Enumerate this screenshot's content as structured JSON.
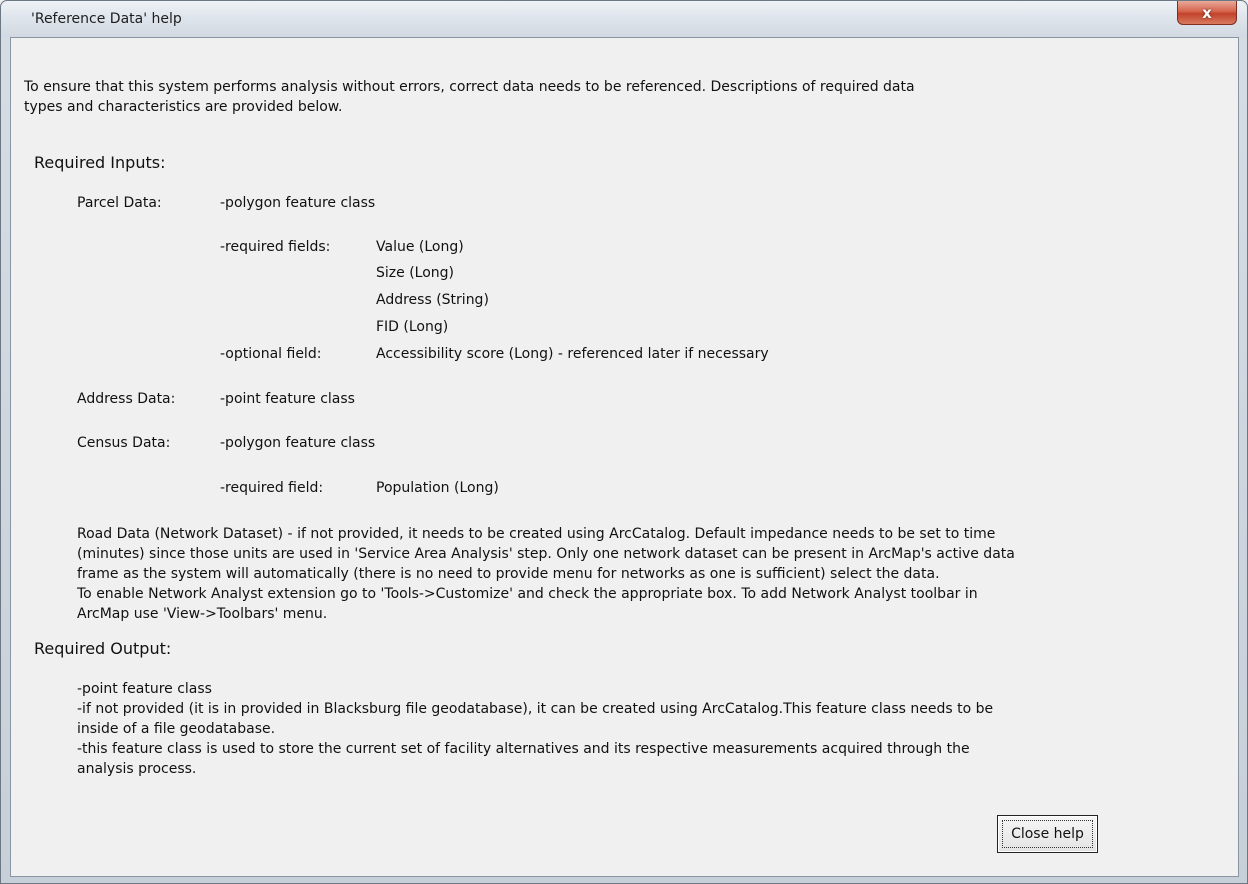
{
  "window": {
    "title": "'Reference Data' help",
    "close_glyph": "x",
    "close_icon_name": "close-icon"
  },
  "intro": {
    "line1": "To ensure that this system performs analysis without errors, correct data needs to be referenced. Descriptions of required data",
    "line2": "types and characteristics are provided below."
  },
  "required_inputs": {
    "heading": "Required Inputs:",
    "parcel": {
      "label": "Parcel Data:",
      "type": "-polygon feature class",
      "required_fields_label": "-required fields:",
      "required_fields": [
        "Value (Long)",
        "Size (Long)",
        "Address (String)",
        "FID (Long)"
      ],
      "optional_field_label": "-optional field:",
      "optional_field": "Accessibility score (Long) - referenced later if necessary"
    },
    "address": {
      "label": "Address Data:",
      "type": "-point feature class"
    },
    "census": {
      "label": "Census Data:",
      "type": "-polygon feature class",
      "required_field_label": "-required field:",
      "required_field": "Population (Long)"
    },
    "road": {
      "lines": [
        "Road Data (Network Dataset) - if not provided, it needs to be created using ArcCatalog. Default impedance needs to be set to time",
        "(minutes) since those units are used in 'Service Area Analysis' step. Only one network dataset can be present in ArcMap's active data",
        "frame as the system will automatically (there is no need to provide menu for networks as one is sufficient) select the data.",
        "To enable Network Analyst extension go to 'Tools->Customize' and check the appropriate box. To add Network Analyst toolbar in",
        "ArcMap use 'View->Toolbars' menu."
      ]
    }
  },
  "required_output": {
    "heading": "Required Output:",
    "lines": [
      "-point feature class",
      "-if not provided (it is in provided in Blacksburg file geodatabase), it can be created using ArcCatalog.This feature class needs to be",
      "inside of a file geodatabase.",
      "-this feature class is used to store the current set of facility alternatives and its respective measurements acquired through the",
      "analysis process."
    ]
  },
  "buttons": {
    "close_help": "Close help"
  }
}
